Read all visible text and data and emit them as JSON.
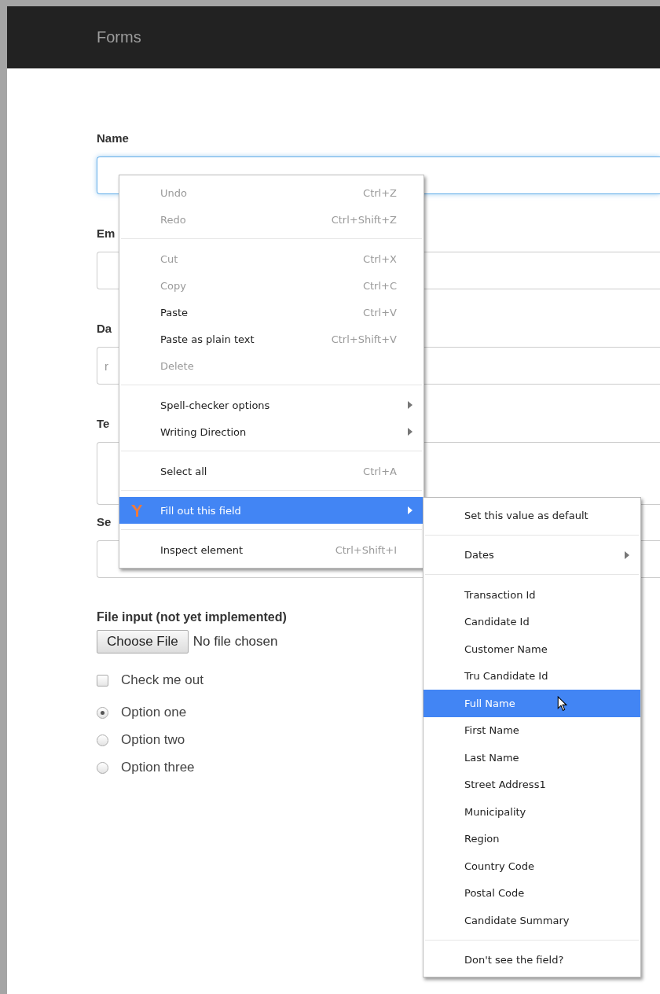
{
  "navbar": {
    "title": "Forms"
  },
  "fields": [
    {
      "label": "Name",
      "kind": "input",
      "focused": true
    },
    {
      "label": "Em",
      "kind": "input",
      "focused": false
    },
    {
      "label": "Da",
      "kind": "input",
      "focused": false,
      "placeholder": "r"
    },
    {
      "label": "Te",
      "kind": "textarea",
      "focused": false
    },
    {
      "label": "Se",
      "kind": "select",
      "focused": false
    }
  ],
  "file_input": {
    "label": "File input (not yet implemented)",
    "button": "Choose File",
    "status": "No file chosen"
  },
  "checkbox": {
    "label": "Check me out",
    "checked": false
  },
  "radios": [
    {
      "label": "Option one",
      "selected": true
    },
    {
      "label": "Option two",
      "selected": false
    },
    {
      "label": "Option three",
      "selected": false
    }
  ],
  "context_menu": [
    {
      "kind": "item",
      "label": "Undo",
      "shortcut": "Ctrl+Z",
      "disabled": true,
      "selected": false
    },
    {
      "kind": "item",
      "label": "Redo",
      "shortcut": "Ctrl+Shift+Z",
      "disabled": true,
      "selected": false
    },
    {
      "kind": "separator"
    },
    {
      "kind": "item",
      "label": "Cut",
      "shortcut": "Ctrl+X",
      "disabled": true,
      "selected": false
    },
    {
      "kind": "item",
      "label": "Copy",
      "shortcut": "Ctrl+C",
      "disabled": true,
      "selected": false
    },
    {
      "kind": "item",
      "label": "Paste",
      "shortcut": "Ctrl+V",
      "disabled": false,
      "selected": false
    },
    {
      "kind": "item",
      "label": "Paste as plain text",
      "shortcut": "Ctrl+Shift+V",
      "disabled": false,
      "selected": false
    },
    {
      "kind": "item",
      "label": "Delete",
      "disabled": true,
      "selected": false
    },
    {
      "kind": "separator"
    },
    {
      "kind": "item",
      "label": "Spell-checker options",
      "disabled": false,
      "selected": false,
      "submenu": true
    },
    {
      "kind": "item",
      "label": "Writing Direction",
      "disabled": false,
      "selected": false,
      "submenu": true
    },
    {
      "kind": "separator"
    },
    {
      "kind": "item",
      "label": "Select all",
      "shortcut": "Ctrl+A",
      "disabled": false,
      "selected": false
    },
    {
      "kind": "separator"
    },
    {
      "kind": "item",
      "label": "Fill out this field",
      "disabled": false,
      "selected": true,
      "submenu": true,
      "logo": true
    },
    {
      "kind": "separator"
    },
    {
      "kind": "item",
      "label": "Inspect element",
      "shortcut": "Ctrl+Shift+I",
      "disabled": false,
      "selected": false
    }
  ],
  "submenu": [
    {
      "kind": "item",
      "label": "Set this value as default",
      "selected": false
    },
    {
      "kind": "separator"
    },
    {
      "kind": "item",
      "label": "Dates",
      "selected": false,
      "submenu": true
    },
    {
      "kind": "separator"
    },
    {
      "kind": "item",
      "label": "Transaction Id",
      "selected": false
    },
    {
      "kind": "item",
      "label": "Candidate Id",
      "selected": false
    },
    {
      "kind": "item",
      "label": "Customer Name",
      "selected": false
    },
    {
      "kind": "item",
      "label": "Tru Candidate Id",
      "selected": false
    },
    {
      "kind": "item",
      "label": "Full Name",
      "selected": true
    },
    {
      "kind": "item",
      "label": "First Name",
      "selected": false
    },
    {
      "kind": "item",
      "label": "Last Name",
      "selected": false
    },
    {
      "kind": "item",
      "label": "Street Address1",
      "selected": false
    },
    {
      "kind": "item",
      "label": "Municipality",
      "selected": false
    },
    {
      "kind": "item",
      "label": "Region",
      "selected": false
    },
    {
      "kind": "item",
      "label": "Country Code",
      "selected": false
    },
    {
      "kind": "item",
      "label": "Postal Code",
      "selected": false
    },
    {
      "kind": "item",
      "label": "Candidate Summary",
      "selected": false
    },
    {
      "kind": "separator"
    },
    {
      "kind": "item",
      "label": "Don't see the field?",
      "selected": false
    }
  ]
}
